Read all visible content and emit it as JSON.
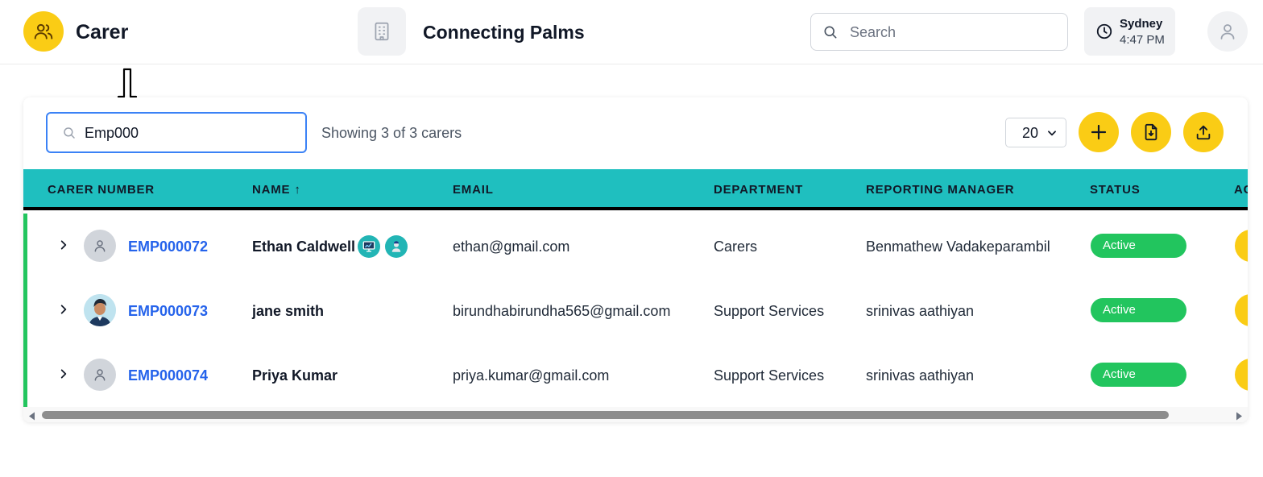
{
  "header": {
    "app_title": "Carer",
    "org_name": "Connecting Palms",
    "search_placeholder": "Search",
    "clock": {
      "city": "Sydney",
      "time": "4:47 PM"
    }
  },
  "toolbar": {
    "search_value": "Emp000",
    "showing_text": "Showing 3 of 3 carers",
    "page_size": "20"
  },
  "table": {
    "columns": [
      "CARER NUMBER",
      "NAME ↑",
      "EMAIL",
      "DEPARTMENT",
      "REPORTING MANAGER",
      "STATUS",
      "AC"
    ],
    "rows": [
      {
        "carer_number": "EMP000072",
        "name": "Ethan Caldwell",
        "email": "ethan@gmail.com",
        "department": "Carers",
        "manager": "Benmathew Vadakeparambil",
        "status": "Active"
      },
      {
        "carer_number": "EMP000073",
        "name": "jane smith",
        "email": "birundhabirundha565@gmail.com",
        "department": "Support Services",
        "manager": "srinivas aathiyan",
        "status": "Active"
      },
      {
        "carer_number": "EMP000074",
        "name": "Priya Kumar",
        "email": "priya.kumar@gmail.com",
        "department": "Support Services",
        "manager": "srinivas aathiyan",
        "status": "Active"
      }
    ]
  },
  "colors": {
    "accent": "#facc15",
    "header_teal": "#1fbfbf",
    "status_active": "#22c55e",
    "link_blue": "#2563eb"
  },
  "icons": {
    "app": "users-icon",
    "org": "building-icon",
    "search": "search-icon",
    "clock": "clock-icon",
    "user": "user-icon",
    "add": "plus-icon",
    "download": "file-download-icon",
    "upload": "upload-icon"
  }
}
